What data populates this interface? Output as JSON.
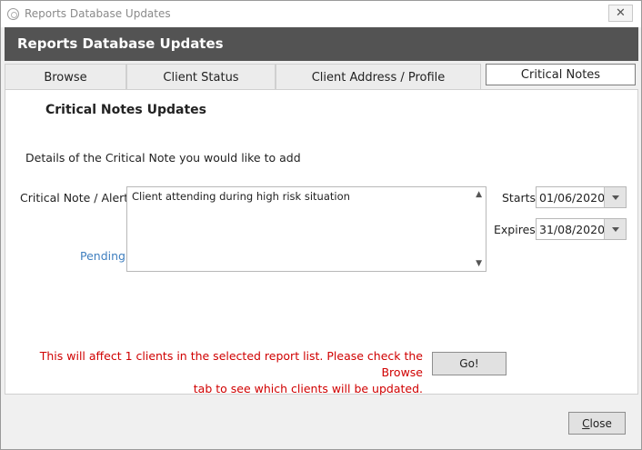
{
  "window": {
    "title": "Reports Database Updates",
    "close_glyph": "✕"
  },
  "header": {
    "title": "Reports Database Updates"
  },
  "tabs": [
    {
      "label": "Browse"
    },
    {
      "label": "Client Status"
    },
    {
      "label": "Client Address / Profile"
    },
    {
      "label": "Critical Notes",
      "active": true
    }
  ],
  "main": {
    "section_title": "Critical Notes Updates",
    "details_text": "Details of the Critical Note you would like to add",
    "note_label": "Critical Note / Alert",
    "pending_label": "Pending",
    "note_value": "Client attending during high risk situation",
    "starts_label": "Starts",
    "starts_value": "01/06/2020",
    "expires_label": "Expires",
    "expires_value": "31/08/2020",
    "warning_line1": "This will affect 1 clients in the selected report list. Please check the Browse",
    "warning_line2": "tab to see which clients will be updated.",
    "go_label": "Go!"
  },
  "footer": {
    "close_label_first": "C",
    "close_label_rest": "lose"
  },
  "colors": {
    "header_band": "#535353",
    "warning_text": "#d00000",
    "pending_text": "#3f7fbf"
  },
  "icons": {
    "dropdown": "chevron-down-icon",
    "scroll_up": "scroll-up-icon",
    "scroll_down": "scroll-down-icon"
  }
}
